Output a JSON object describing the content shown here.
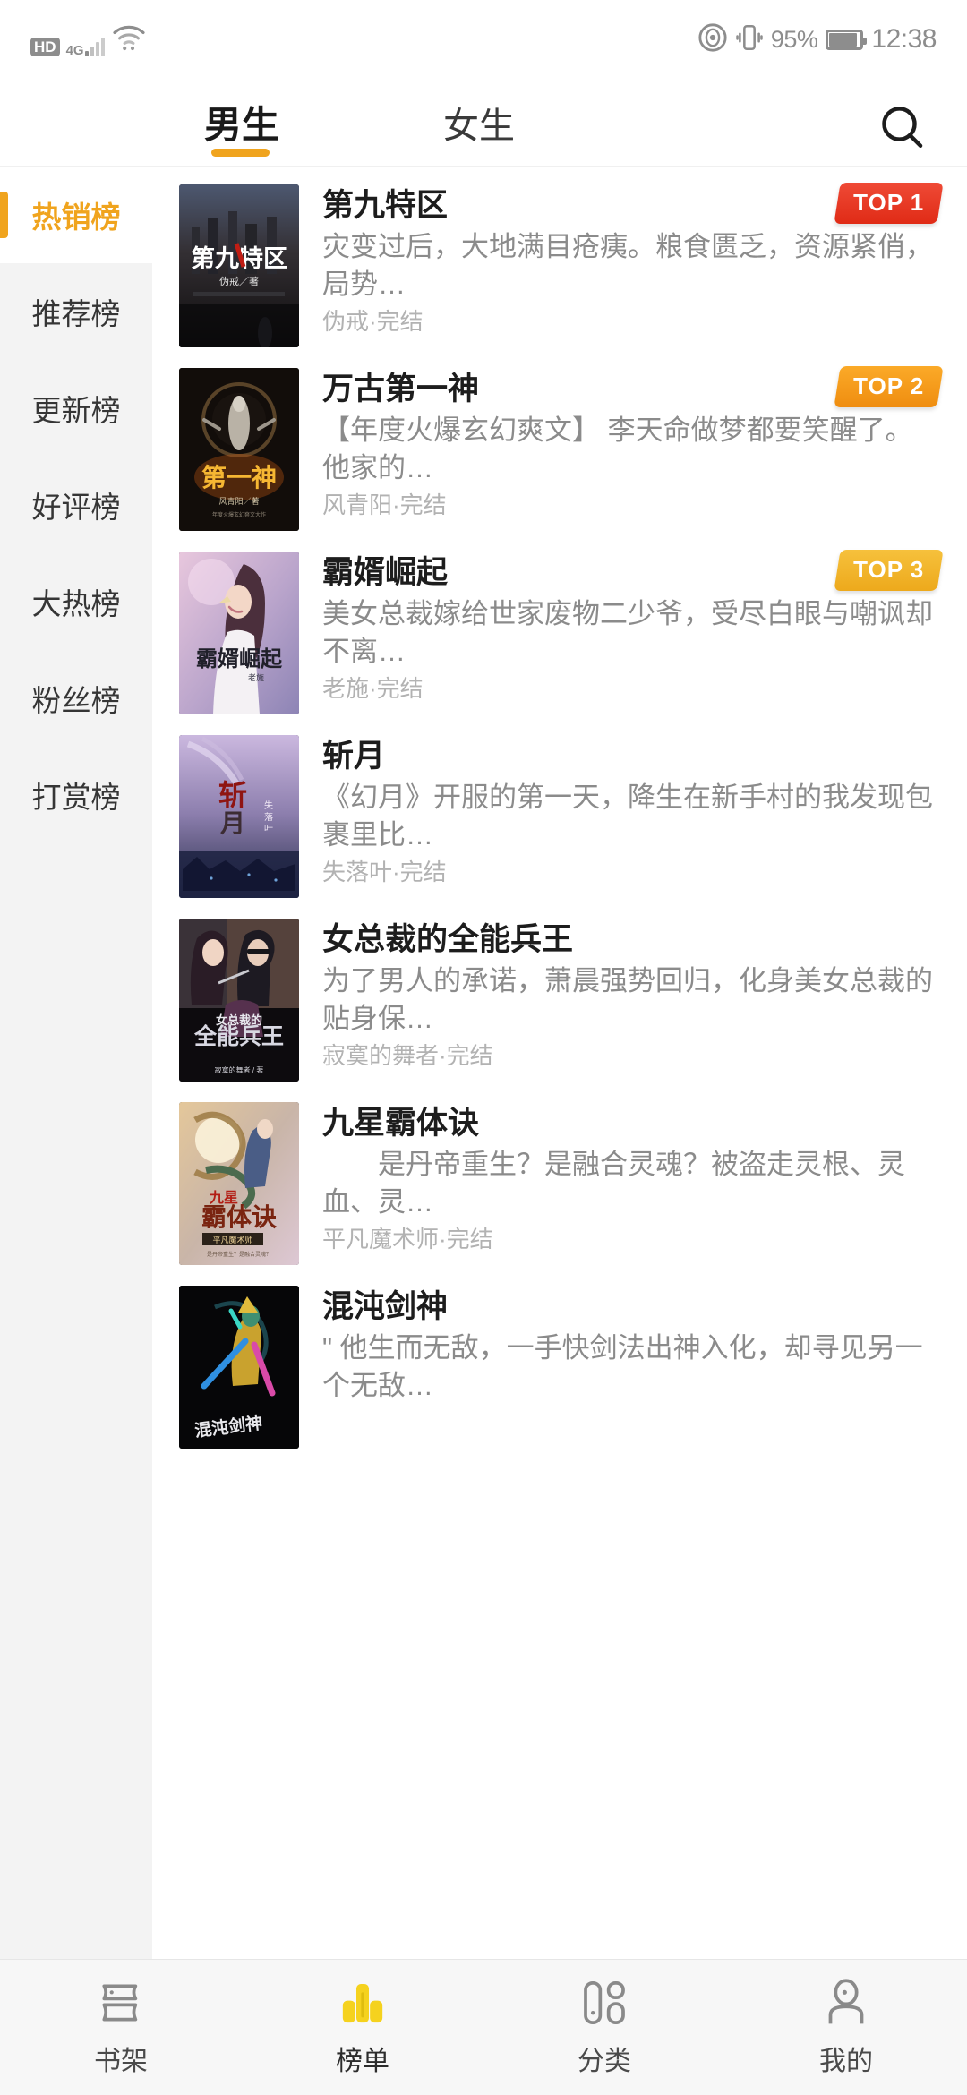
{
  "status_bar": {
    "hd_label": "HD",
    "network_label": "4G",
    "battery_percent": "95%",
    "time": "12:38",
    "icons": [
      "hd-badge",
      "signal-bars-icon",
      "wifi-icon",
      "eye-icon",
      "vibrate-icon",
      "battery-icon"
    ]
  },
  "header": {
    "tabs": [
      {
        "label": "男生",
        "active": true
      },
      {
        "label": "女生",
        "active": false
      }
    ],
    "search_icon": "search-icon",
    "active_underline_color": "#f0a41e"
  },
  "sidebar": {
    "items": [
      {
        "label": "热销榜",
        "active": true
      },
      {
        "label": "推荐榜",
        "active": false
      },
      {
        "label": "更新榜",
        "active": false
      },
      {
        "label": "好评榜",
        "active": false
      },
      {
        "label": "大热榜",
        "active": false
      },
      {
        "label": "粉丝榜",
        "active": false
      },
      {
        "label": "打赏榜",
        "active": false
      }
    ],
    "active_color": "#f0a41e"
  },
  "books": [
    {
      "title": "第九特区",
      "desc": "灾变过后，大地满目疮痍。粮食匮乏，资源紧俏，局势…",
      "meta": "伪戒·完结",
      "badge": "TOP 1",
      "badge_color": "#eb3a27",
      "cover": "post-apocalyptic-city-cover"
    },
    {
      "title": "万古第一神",
      "desc": "【年度火爆玄幻爽文】 李天命做梦都要笑醒了。 他家的…",
      "meta": "风青阳·完结",
      "badge": "TOP 2",
      "badge_color": "#f59a1b",
      "cover": "dark-deity-cover"
    },
    {
      "title": "霸婿崛起",
      "desc": "美女总裁嫁给世家废物二少爷，受尽白眼与嘲讽却不离…",
      "meta": "老施·完结",
      "badge": "TOP 3",
      "badge_color": "#f1b41f",
      "cover": "pink-woman-cover"
    },
    {
      "title": "斩月",
      "desc": "《幻月》开服的第一天，降生在新手村的我发现包裹里比…",
      "meta": "失落叶·完结",
      "badge": "",
      "badge_color": "",
      "cover": "purple-moon-cover"
    },
    {
      "title": "女总裁的全能兵王",
      "desc": "为了男人的承诺，萧晨强势回归，化身美女总裁的贴身保…",
      "meta": "寂寞的舞者·完结",
      "badge": "",
      "badge_color": "",
      "cover": "couple-dark-cover"
    },
    {
      "title": "九星霸体诀",
      "desc": "　　是丹帝重生？是融合灵魂？被盗走灵根、灵血、灵…",
      "meta": "平凡魔术师·完结",
      "badge": "",
      "badge_color": "",
      "cover": "dragon-warrior-cover"
    },
    {
      "title": "混沌剑神",
      "desc": "\" 他生而无敌，一手快剑法出神入化，却寻见另一个无敌…",
      "meta": "",
      "badge": "",
      "badge_color": "",
      "cover": "chaos-sword-cover"
    }
  ],
  "bottom_nav": {
    "items": [
      {
        "label": "书架",
        "icon": "bookshelf-icon",
        "active": false
      },
      {
        "label": "榜单",
        "icon": "ranking-bars-icon",
        "active": true
      },
      {
        "label": "分类",
        "icon": "category-grid-icon",
        "active": false
      },
      {
        "label": "我的",
        "icon": "user-profile-icon",
        "active": false
      }
    ],
    "active_color": "#f5d21e"
  }
}
